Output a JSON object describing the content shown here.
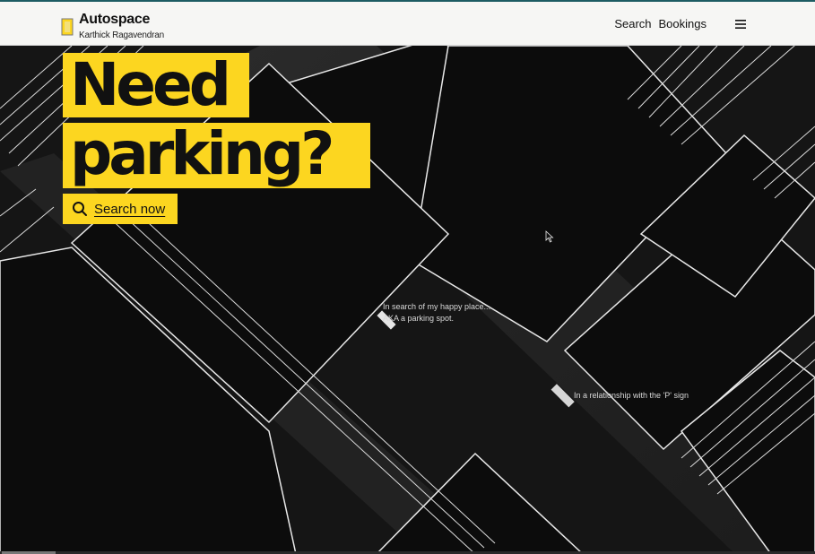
{
  "header": {
    "brand_title": "Autospace",
    "brand_subtitle": "Karthick Ragavendran",
    "nav": {
      "search": "Search",
      "bookings": "Bookings"
    }
  },
  "hero": {
    "headline_line1": "Need",
    "headline_line2": "parking?",
    "cta_label": "Search now",
    "caption1_line1": "In search of my happy place...",
    "caption1_line2": "AKA a parking spot.",
    "caption2": "In a relationship with the 'P' sign"
  },
  "icons": {
    "logo": "parking-logo-icon",
    "menu": "hamburger-menu-icon",
    "search": "search-icon",
    "cursor": "mouse-pointer-icon"
  },
  "colors": {
    "accent": "#fcd620",
    "header_bg": "#f6f6f4",
    "hero_bg": "#111111",
    "top_border": "#1d5c63"
  }
}
